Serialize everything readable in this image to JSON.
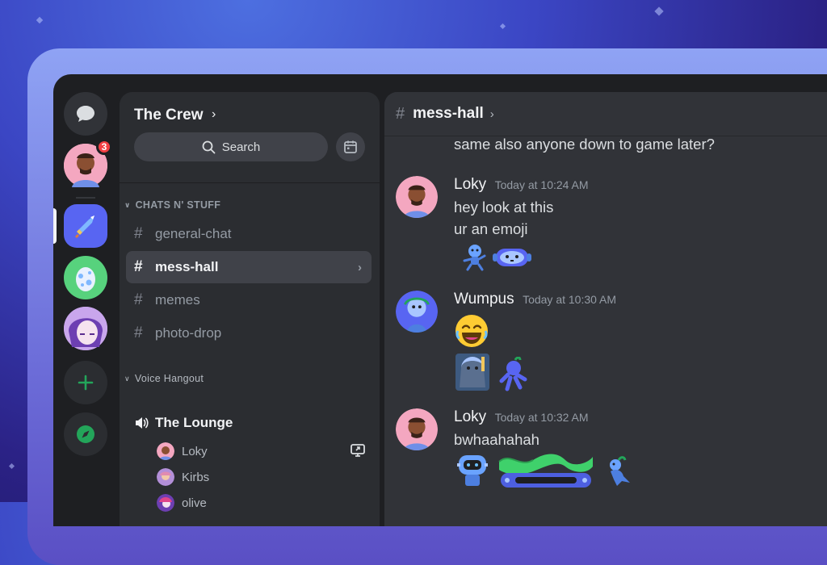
{
  "server": {
    "name": "The Crew",
    "notification_count": "3"
  },
  "search": {
    "label": "Search"
  },
  "categories": [
    {
      "label": "CHATS N' STUFF"
    },
    {
      "label": "Voice Hangout"
    }
  ],
  "channels": [
    {
      "name": "general-chat",
      "active": false
    },
    {
      "name": "mess-hall",
      "active": true
    },
    {
      "name": "memes",
      "active": false
    },
    {
      "name": "photo-drop",
      "active": false
    }
  ],
  "voice_channel": {
    "name": "The Lounge",
    "users": [
      "Loky",
      "Kirbs",
      "olive"
    ]
  },
  "current_channel": {
    "name": "mess-hall"
  },
  "messages": [
    {
      "author": "",
      "time": "",
      "lines": [
        "same also anyone down to game later?"
      ]
    },
    {
      "author": "Loky",
      "time": "Today at 10:24 AM",
      "lines": [
        "hey look at this",
        "ur an emoji"
      ]
    },
    {
      "author": "Wumpus",
      "time": "Today at 10:30 AM",
      "lines": []
    },
    {
      "author": "Loky",
      "time": "Today at 10:32 AM",
      "lines": [
        "bwhaahahah"
      ]
    }
  ],
  "colors": {
    "blurple": "#5865f2",
    "background": "#313338",
    "sidebar": "#2b2d31",
    "rail": "#1e1f22",
    "green": "#23a55a",
    "red_badge": "#f23f43"
  },
  "icons": [
    "chat-bubble-icon",
    "sword-icon",
    "egg-icon",
    "plus-icon",
    "compass-icon",
    "search-icon",
    "calendar-icon",
    "speaker-icon",
    "screen-share-icon",
    "hash-icon"
  ]
}
